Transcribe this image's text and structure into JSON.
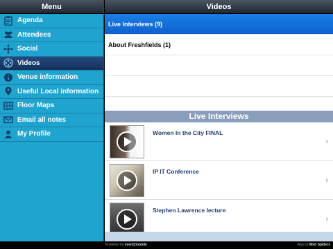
{
  "sidebar": {
    "title": "Menu",
    "items": [
      {
        "label": "Agenda",
        "icon": "clipboard-icon"
      },
      {
        "label": "Attendees",
        "icon": "people-icon"
      },
      {
        "label": "Social",
        "icon": "share-icon"
      },
      {
        "label": "Videos",
        "icon": "film-reel-icon",
        "active": true
      },
      {
        "label": "Venue information",
        "icon": "info-icon"
      },
      {
        "label": "Useful Local information",
        "icon": "map-pin-icon"
      },
      {
        "label": "Floor Maps",
        "icon": "floor-map-icon"
      },
      {
        "label": "Email all notes",
        "icon": "envelope-icon"
      },
      {
        "label": "My Profile",
        "icon": "person-icon"
      }
    ]
  },
  "main": {
    "title": "Videos",
    "categories": [
      {
        "label": "Live Interviews (9)",
        "selected": true
      },
      {
        "label": "About Freshfields (1)",
        "selected": false
      }
    ],
    "section_title": "Live Interviews",
    "videos": [
      {
        "title": "Women In the City FINAL"
      },
      {
        "title": "IP IT Conference"
      },
      {
        "title": "Stephen Lawrence lecture"
      }
    ]
  },
  "footer": {
    "powered_prefix": "Powered by",
    "powered_brand": "event2mobile",
    "app_prefix": "App by",
    "app_brand": "Web Spiders"
  },
  "colors": {
    "sidebar_bg": "#1fa3cf",
    "active_item": "#1d3f6e",
    "selected_row": "#1270dc",
    "section_header": "#8a9ebc"
  }
}
